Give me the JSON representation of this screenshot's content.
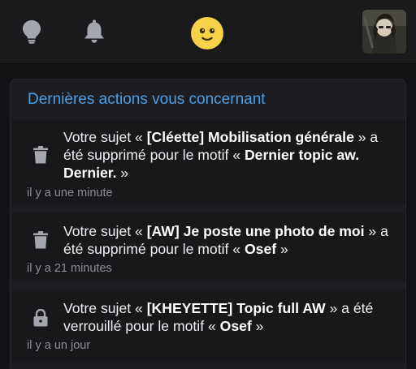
{
  "header": {
    "icons": [
      "lightbulb-icon",
      "bell-icon",
      "smiley-icon",
      "avatar"
    ]
  },
  "panel": {
    "title": "Dernières actions vous concernant"
  },
  "notifications": [
    {
      "icon": "trash-icon",
      "t1": "Votre sujet « ",
      "b1": "[Cléette] Mobilisation générale",
      "t2": " » a été supprimé pour le motif « ",
      "b2": "Dernier topic aw. Dernier.",
      "t3": " »",
      "time": "il y a une minute"
    },
    {
      "icon": "trash-icon",
      "t1": "Votre sujet « ",
      "b1": "[AW] Je poste une photo de moi",
      "t2": " » a été supprimé pour le motif « ",
      "b2": "Osef",
      "t3": " »",
      "time": "il y a 21 minutes"
    },
    {
      "icon": "lock-icon",
      "t1": "Votre sujet « ",
      "b1": "[KHEYETTE] Topic full AW",
      "t2": " » a été verrouillé pour le motif « ",
      "b2": "Osef",
      "t3": " »",
      "time": "il y a un jour"
    }
  ],
  "colors": {
    "background": "#131316",
    "topbar": "#1a1a1d",
    "panel": "#1d1d21",
    "item": "#18181b",
    "accent": "#4a9fe8",
    "smiley": "#f7d148",
    "muted": "#8c8c94"
  }
}
